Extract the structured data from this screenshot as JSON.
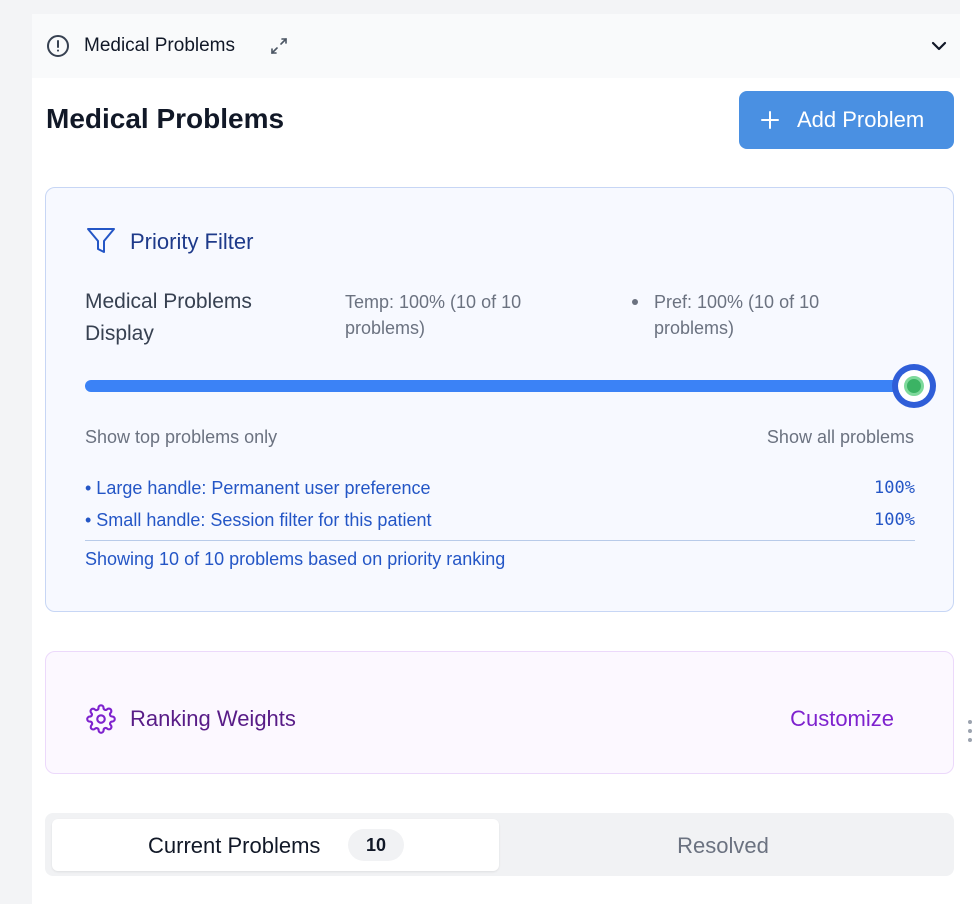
{
  "section": {
    "title": "Medical Problems",
    "icons": {
      "status": "alert-circle-icon",
      "expand": "expand-arrows-icon",
      "collapse": "chevron-down-icon"
    }
  },
  "main": {
    "title": "Medical Problems",
    "add_button_label": "Add Problem",
    "add_icon": "plus-icon"
  },
  "priority_filter": {
    "title": "Priority Filter",
    "icon": "filter-icon",
    "display_label": "Medical Problems Display",
    "temp_text": "Temp: 100% (10 of 10 problems)",
    "pref_text": "Pref: 100% (10 of 10 problems)",
    "slider_level_percent": 100,
    "range_min_label": "Show top problems only",
    "range_max_label": "Show all problems",
    "legend": [
      {
        "label": "• Large handle: Permanent user preference",
        "value": "100%"
      },
      {
        "label": "• Small handle: Session filter for this patient",
        "value": "100%"
      }
    ],
    "summary": "Showing 10 of 10 problems based on priority ranking"
  },
  "ranking_weights": {
    "title": "Ranking Weights",
    "icon": "gear-icon",
    "customize_label": "Customize"
  },
  "tabs": [
    {
      "label": "Current Problems",
      "count": "10",
      "active": true
    },
    {
      "label": "Resolved",
      "active": false
    }
  ],
  "colors": {
    "accent": "#4a90e2",
    "slider": "#3b82f6",
    "handle_core": "#3bb364",
    "filter_text": "#2456c6",
    "weights_text": "#581c87",
    "customize": "#7e22ce"
  }
}
